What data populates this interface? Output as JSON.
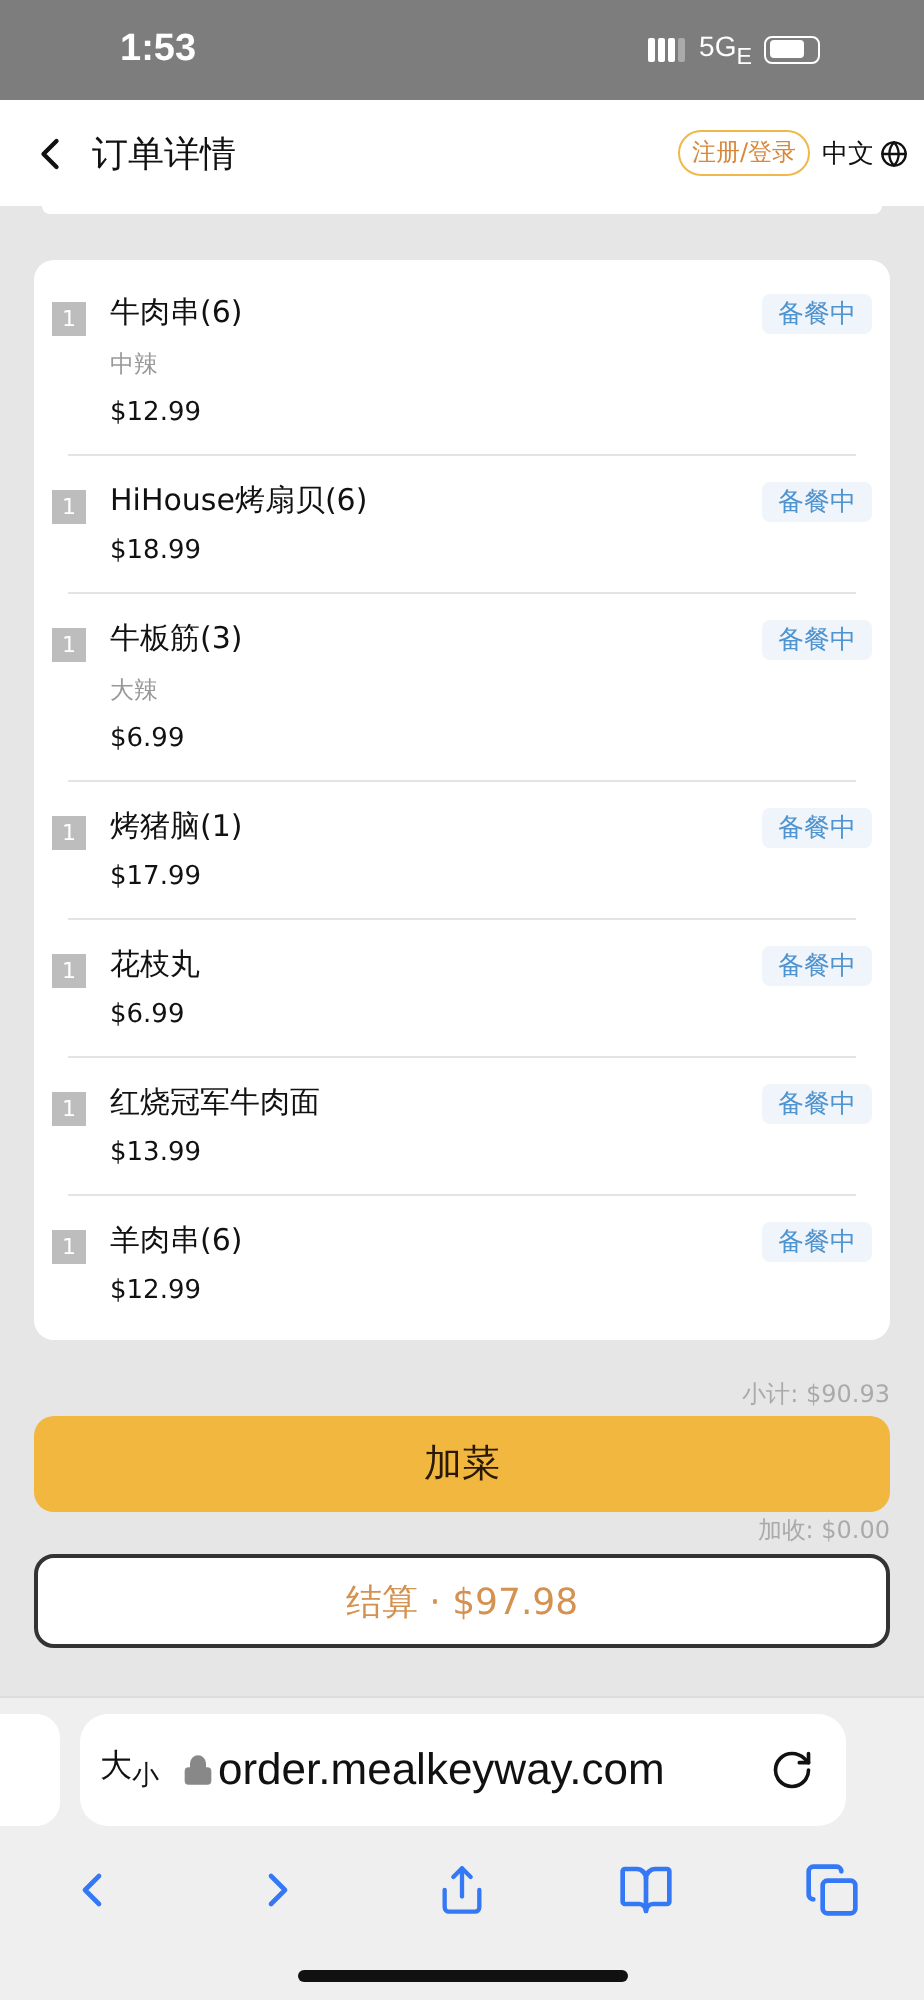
{
  "status_bar": {
    "time": "1:53",
    "network": "5G$_{E}$"
  },
  "header": {
    "title": "订单详情",
    "login": "注册/登录",
    "language": "中文"
  },
  "items": [
    {
      "qty": "1",
      "name": "牛肉串(6)",
      "note": "中辣",
      "price": "$12.99",
      "status": "备餐中"
    },
    {
      "qty": "1",
      "name": "HiHouse烤扇贝(6)",
      "price": "$18.99",
      "status": "备餐中"
    },
    {
      "qty": "1",
      "name": "牛板筋(3)",
      "note": "大辣",
      "price": "$6.99",
      "status": "备餐中"
    },
    {
      "qty": "1",
      "name": "烤猪脑(1)",
      "price": "$17.99",
      "status": "备餐中"
    },
    {
      "qty": "1",
      "name": "花枝丸",
      "price": "$6.99",
      "status": "备餐中"
    },
    {
      "qty": "1",
      "name": "红烧冠军牛肉面",
      "price": "$13.99",
      "status": "备餐中"
    },
    {
      "qty": "1",
      "name": "羊肉串(6)",
      "price": "$12.99",
      "status": "备餐中"
    }
  ],
  "summary": {
    "subtotal": "小计: $90.93",
    "surcharge": "加收: $0.00"
  },
  "buttons": {
    "add": "加菜",
    "checkout": "结算 · $97.98"
  },
  "browser": {
    "text_size": "大$_{小}$",
    "url": "order.mealkeyway.com"
  }
}
